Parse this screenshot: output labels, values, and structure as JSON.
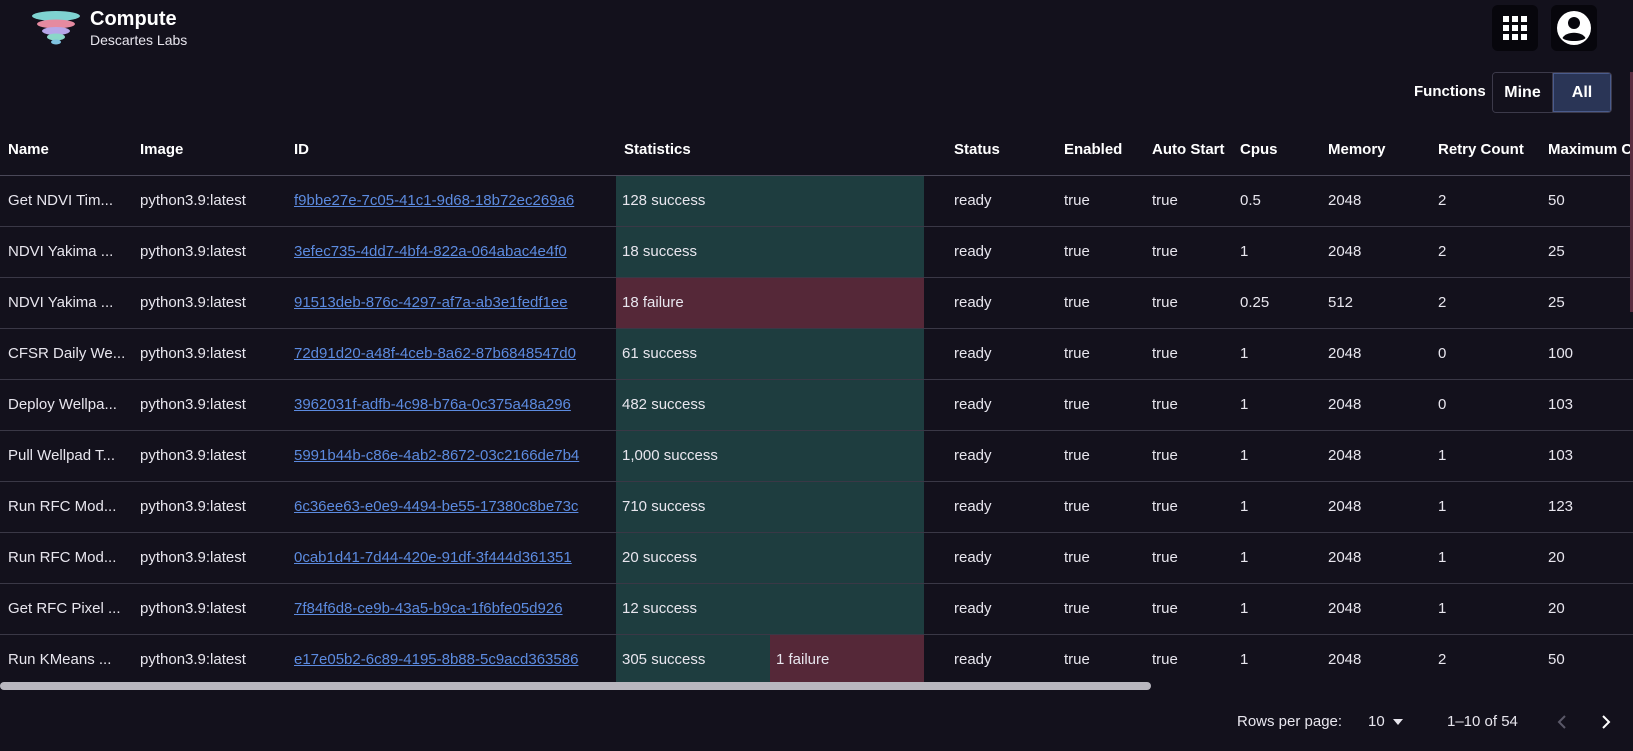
{
  "app": {
    "title": "Compute",
    "subtitle": "Descartes Labs"
  },
  "header": {
    "apps_icon": "apps-grid-icon",
    "account_icon": "account-circle-icon"
  },
  "filter": {
    "label": "Functions",
    "options": [
      "Mine",
      "All"
    ],
    "selected": "All"
  },
  "table": {
    "columns": [
      "Name",
      "Image",
      "ID",
      "Statistics",
      "Status",
      "Enabled",
      "Auto Start",
      "Cpus",
      "Memory",
      "Retry Count",
      "Maximum C"
    ],
    "rows": [
      {
        "name": "Get NDVI Tim...",
        "image": "python3.9:latest",
        "id": "f9bbe27e-7c05-41c1-9d68-18b72ec269a6",
        "success": "128 success",
        "failure": "",
        "status": "ready",
        "enabled": "true",
        "auto_start": "true",
        "cpus": "0.5",
        "memory": "2048",
        "retry_count": "2",
        "maximum": "50"
      },
      {
        "name": "NDVI Yakima ...",
        "image": "python3.9:latest",
        "id": "3efec735-4dd7-4bf4-822a-064abac4e4f0",
        "success": "18 success",
        "failure": "",
        "status": "ready",
        "enabled": "true",
        "auto_start": "true",
        "cpus": "1",
        "memory": "2048",
        "retry_count": "2",
        "maximum": "25"
      },
      {
        "name": "NDVI Yakima ...",
        "image": "python3.9:latest",
        "id": "91513deb-876c-4297-af7a-ab3e1fedf1ee",
        "success": "",
        "failure": "18 failure",
        "status": "ready",
        "enabled": "true",
        "auto_start": "true",
        "cpus": "0.25",
        "memory": "512",
        "retry_count": "2",
        "maximum": "25"
      },
      {
        "name": "CFSR Daily We...",
        "image": "python3.9:latest",
        "id": "72d91d20-a48f-4ceb-8a62-87b6848547d0",
        "success": "61 success",
        "failure": "",
        "status": "ready",
        "enabled": "true",
        "auto_start": "true",
        "cpus": "1",
        "memory": "2048",
        "retry_count": "0",
        "maximum": "100"
      },
      {
        "name": "Deploy Wellpa...",
        "image": "python3.9:latest",
        "id": "3962031f-adfb-4c98-b76a-0c375a48a296",
        "success": "482 success",
        "failure": "",
        "status": "ready",
        "enabled": "true",
        "auto_start": "true",
        "cpus": "1",
        "memory": "2048",
        "retry_count": "0",
        "maximum": "103"
      },
      {
        "name": "Pull Wellpad T...",
        "image": "python3.9:latest",
        "id": "5991b44b-c86e-4ab2-8672-03c2166de7b4",
        "success": "1,000 success",
        "failure": "",
        "status": "ready",
        "enabled": "true",
        "auto_start": "true",
        "cpus": "1",
        "memory": "2048",
        "retry_count": "1",
        "maximum": "103"
      },
      {
        "name": "Run RFC Mod...",
        "image": "python3.9:latest",
        "id": "6c36ee63-e0e9-4494-be55-17380c8be73c",
        "success": "710 success",
        "failure": "",
        "status": "ready",
        "enabled": "true",
        "auto_start": "true",
        "cpus": "1",
        "memory": "2048",
        "retry_count": "1",
        "maximum": "123"
      },
      {
        "name": "Run RFC Mod...",
        "image": "python3.9:latest",
        "id": "0cab1d41-7d44-420e-91df-3f444d361351",
        "success": "20 success",
        "failure": "",
        "status": "ready",
        "enabled": "true",
        "auto_start": "true",
        "cpus": "1",
        "memory": "2048",
        "retry_count": "1",
        "maximum": "20"
      },
      {
        "name": "Get RFC Pixel ...",
        "image": "python3.9:latest",
        "id": "7f84f6d8-ce9b-43a5-b9ca-1f6bfe05d926",
        "success": "12 success",
        "failure": "",
        "status": "ready",
        "enabled": "true",
        "auto_start": "true",
        "cpus": "1",
        "memory": "2048",
        "retry_count": "1",
        "maximum": "20"
      },
      {
        "name": "Run KMeans ...",
        "image": "python3.9:latest",
        "id": "e17e05b2-6c89-4195-8b88-5c9acd363586",
        "success": "305 success",
        "failure": "1 failure",
        "status": "ready",
        "enabled": "true",
        "auto_start": "true",
        "cpus": "1",
        "memory": "2048",
        "retry_count": "2",
        "maximum": "50"
      }
    ]
  },
  "pagination": {
    "rows_label": "Rows per page:",
    "rows_value": "10",
    "range": "1–10 of 54"
  },
  "colors": {
    "background": "#13111c",
    "success": "#1e3d3f",
    "failure": "#552838",
    "link": "#5c8be0",
    "toggle_active": "#2a3556"
  }
}
